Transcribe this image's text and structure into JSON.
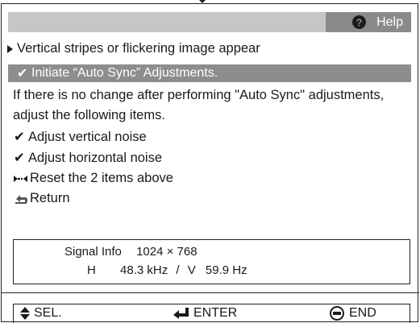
{
  "help": {
    "label": "Help",
    "icon": "question-circle-icon"
  },
  "menu": {
    "section_title": "Vertical stripes or flickering image appear",
    "selected_item": "Initiate “Auto Sync” Adjustments.",
    "description": "If there is no change after performing \"Auto Sync\" adjustments, adjust the following items.",
    "items": [
      {
        "label": "Adjust vertical noise",
        "icon": "checkmark-icon"
      },
      {
        "label": "Adjust horizontal noise",
        "icon": "checkmark-icon"
      },
      {
        "label": "Reset the 2 items above",
        "icon": "reset-arrows-icon"
      },
      {
        "label": "Return",
        "icon": "return-arrow-icon"
      }
    ]
  },
  "signal_info": {
    "label": "Signal Info",
    "resolution": "1024 × 768",
    "h_label": "H",
    "h_value": "48.3 kHz",
    "separator": "/",
    "v_label": "V",
    "v_value": "59.9 Hz"
  },
  "footer": {
    "sel_label": "SEL.",
    "enter_label": "ENTER",
    "end_label": "END"
  },
  "colors": {
    "titlebar": "#c6c6c6",
    "selected": "#8d8d8d",
    "help_tab": "#8a8a8a"
  }
}
